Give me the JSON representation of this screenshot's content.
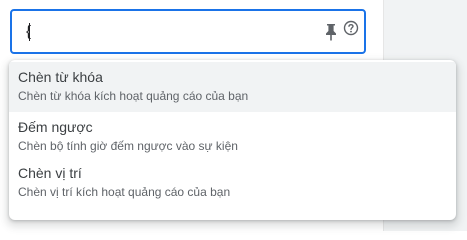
{
  "input": {
    "value": "{"
  },
  "dropdown": {
    "items": [
      {
        "title": "Chèn từ khóa",
        "description": "Chèn từ khóa kích hoạt quảng cáo của bạn"
      },
      {
        "title": "Đếm ngược",
        "description": "Chèn bộ tính giờ đếm ngược vào sự kiện"
      },
      {
        "title": "Chèn vị trí",
        "description": "Chèn vị trí kích hoạt quảng cáo của bạn"
      }
    ]
  },
  "icons": {
    "pin": "pin-icon",
    "help": "help-icon"
  },
  "colors": {
    "focus_border": "#1a73e8",
    "hover_background": "#f1f3f4"
  }
}
